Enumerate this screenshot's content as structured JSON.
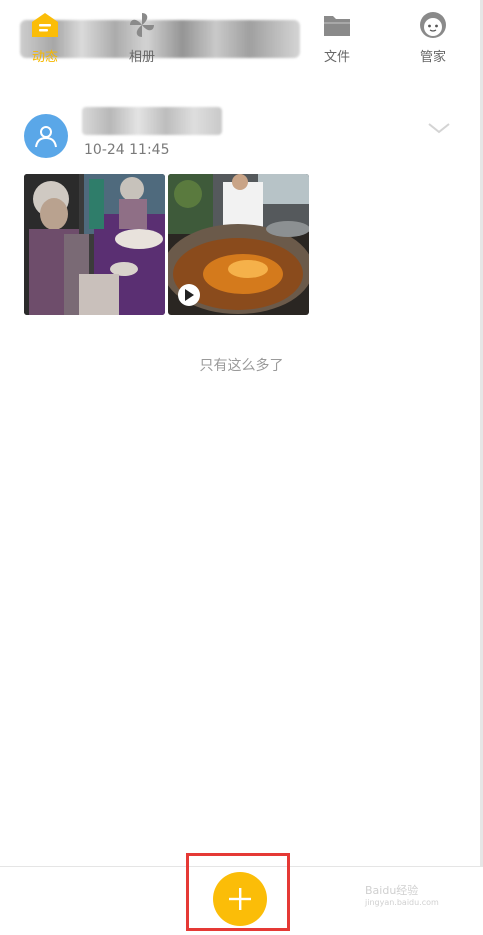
{
  "post": {
    "time": "10-24 11:45"
  },
  "feed": {
    "end_message": "只有这么多了"
  },
  "bottom_nav": {
    "items": [
      {
        "label": "动态",
        "icon": "feed-icon",
        "active": true
      },
      {
        "label": "相册",
        "icon": "pinwheel-album-icon",
        "active": false
      },
      {
        "label": "文件",
        "icon": "folder-icon",
        "active": false
      },
      {
        "label": "管家",
        "icon": "butler-avatar-icon",
        "active": false
      }
    ],
    "fab_icon": "plus-icon"
  },
  "watermark": {
    "line1": "Baidu经验",
    "line2": "jingyan.baidu.com"
  },
  "colors": {
    "accent": "#fbbd08",
    "avatar": "#5aa7e8",
    "highlight": "#e53935"
  }
}
